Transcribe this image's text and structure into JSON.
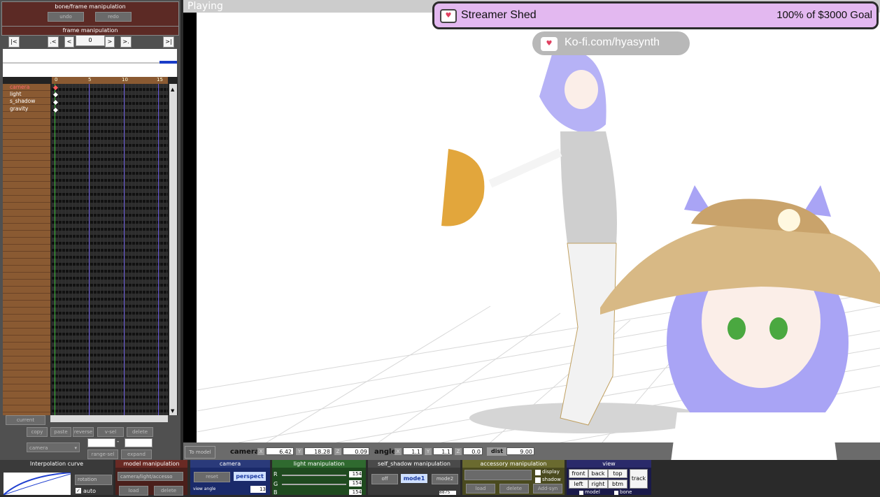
{
  "left_panel": {
    "title": "bone/frame manipulation",
    "undo": "undo",
    "redo": "redo",
    "frame_title": "frame manipulation",
    "nav_first": "|<",
    "nav_prev_key": ".<",
    "nav_prev": "<",
    "frame_value": "0",
    "nav_next": ">",
    "nav_next_key": ">.",
    "nav_last": ">|",
    "ruler_ticks": [
      "0",
      "5",
      "10",
      "15"
    ],
    "track_labels": [
      "camera",
      "light",
      "s_shadow",
      "gravity"
    ],
    "current": "current",
    "copy": "copy",
    "paste": "paste",
    "reverse": "reverse",
    "vsel": "v-sel",
    "delete": "delete",
    "camera_select": "camera",
    "range_sel": "range-sel",
    "expand": "expand",
    "dash": "-"
  },
  "viewport": {
    "status": "Playing",
    "to_model": "To model",
    "camera_label": "camera",
    "x_label": "X",
    "y_label": "Y",
    "z_label": "Z",
    "cam_x": "6.42",
    "cam_y": "18.28",
    "cam_z": "0.09",
    "angle_label": "angle",
    "ang_x": "1.1",
    "ang_y": "1.1",
    "ang_z": "0.0",
    "dist_label": "dist",
    "dist": "9.00"
  },
  "bottom": {
    "interp_title": "Interpolation curve",
    "interp_select": "rotation",
    "auto": "auto",
    "model_title": "model manipulation",
    "model_select": "camera/light/accesso",
    "load": "load",
    "delete": "delete",
    "camera_title": "camera",
    "reset": "reset",
    "perspect": "perspect",
    "view_angle_label": "view angle",
    "view_angle": "13",
    "light_title": "light manipulation",
    "r_label": "R",
    "g_label": "G",
    "b_label": "B",
    "r_value": "154",
    "g_value": "154",
    "b_value": "154",
    "shadow_title": "self_shadow manipulation",
    "off": "off",
    "mode1": "mode1",
    "mode2": "mode2",
    "shadow_value": "8875",
    "accessory_title": "accessory manipulation",
    "acc_load": "load",
    "acc_delete": "delete",
    "add_syn": "Add-syn",
    "display": "display",
    "shadow": "shadow",
    "view_title": "view",
    "front": "front",
    "back": "back",
    "top": "top",
    "left": "left",
    "right": "right",
    "btm": "btm",
    "track": "track",
    "model": "model",
    "bone": "bone"
  },
  "overlay": {
    "goal_name": "Streamer Shed",
    "goal_progress": "100% of $3000 Goal",
    "kofi_link": "Ko-fi.com/hyasynth"
  },
  "colors": {
    "panel_header": "#5c2a25",
    "goal_bg": "#e3b8f0",
    "avatar_hair": "#a9a4f5",
    "timeline_labels": "#8a5a32"
  }
}
